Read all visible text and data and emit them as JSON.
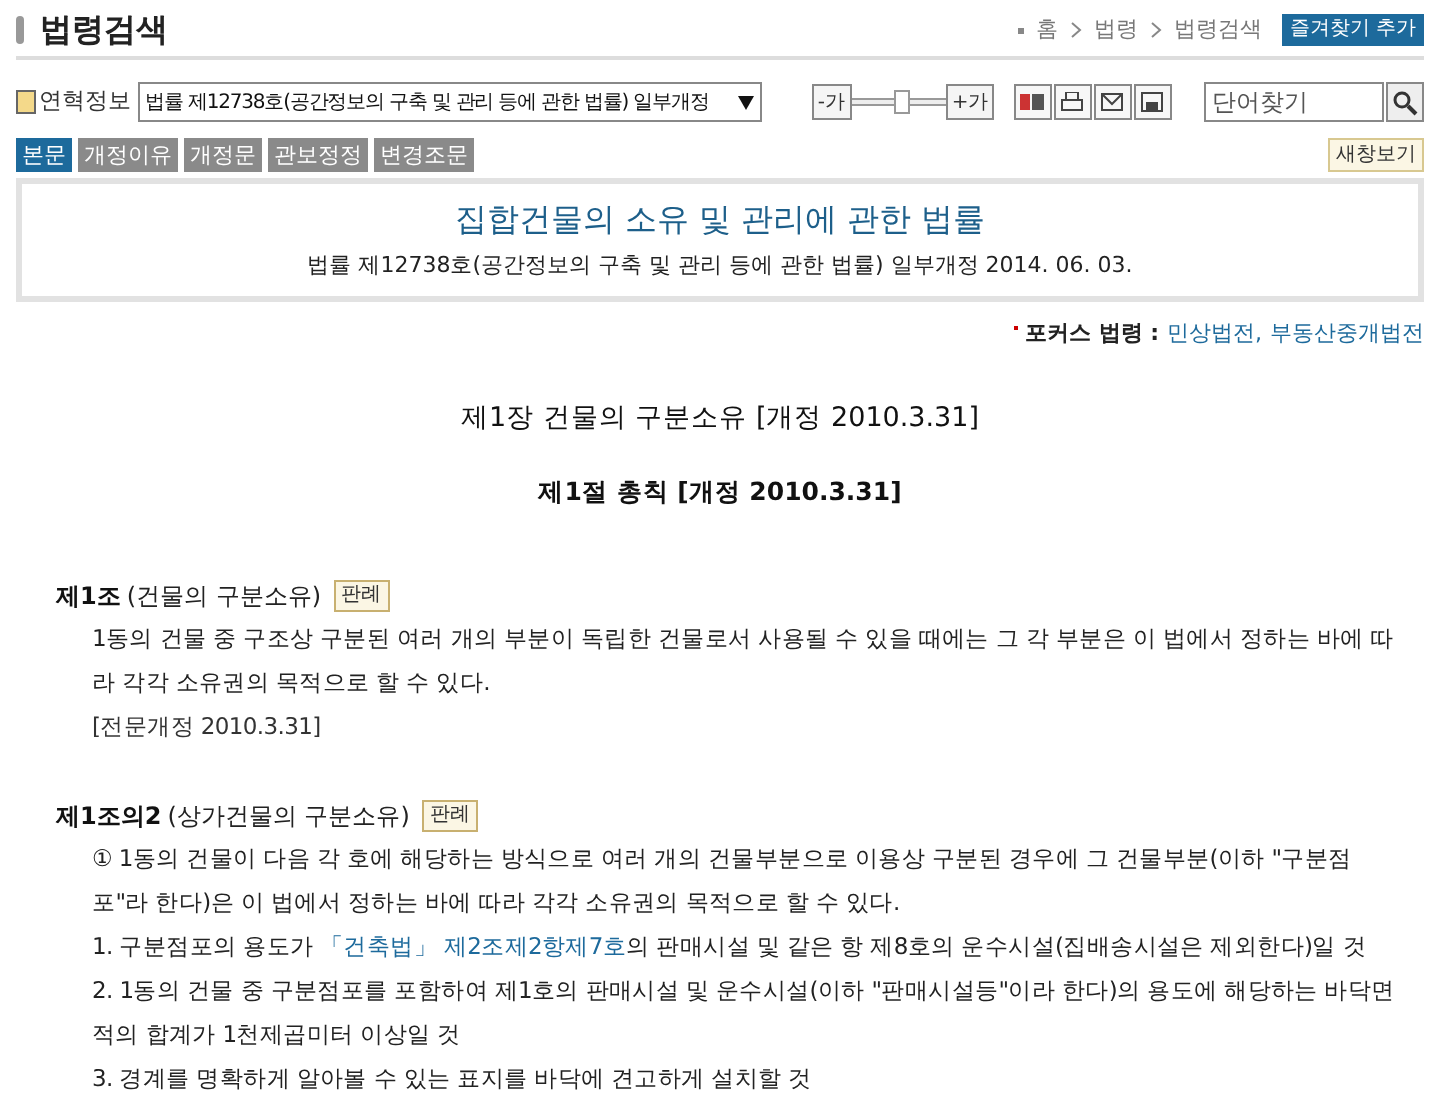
{
  "header": {
    "title": "법령검색",
    "breadcrumbs": [
      "홈",
      "법령",
      "법령검색"
    ],
    "favorite_button": "즐겨찾기 추가"
  },
  "toolbar": {
    "history_label": "연혁정보",
    "history_value": "법률 제12738호(공간정보의 구축 및 관리 등에 관한 법률) 일부개정",
    "font_smaller": "-가",
    "font_larger": "+가",
    "font_slider": {
      "level": 0.5
    },
    "search_placeholder": "단어찾기"
  },
  "tabs": [
    {
      "label": "본문",
      "selected": true
    },
    {
      "label": "개정이유",
      "selected": false
    },
    {
      "label": "개정문",
      "selected": false
    },
    {
      "label": "관보정정",
      "selected": false
    },
    {
      "label": "변경조문",
      "selected": false
    }
  ],
  "new_window_button": "새창보기",
  "law": {
    "title": "집합건물의 소유 및 관리에 관한 법률",
    "subtitle": "법률 제12738호(공간정보의 구축 및 관리 등에 관한 법률) 일부개정 2014. 06. 03."
  },
  "focus": {
    "label": "포커스 법령 :",
    "links": [
      "민상법전,",
      "부동산중개법전"
    ]
  },
  "chapter": "제1장 건물의 구분소유 [개정 2010.3.31]",
  "section": "제1절 총칙 [개정 2010.3.31]",
  "articles": [
    {
      "number": "제1조",
      "heading": "(건물의 구분소유)",
      "case_button": "판례",
      "paragraphs": [
        {
          "kind": "text",
          "parts": [
            {
              "text": "1동의 건물 중 구조상 구분된 여러 개의 부분이 독립한 건물로서 사용될 수 있을 때에는 그 각 부분은 이 법에서 정하는 바에 따라 각각 소유권의 목적으로 할 수 있다."
            }
          ]
        },
        {
          "kind": "note",
          "parts": [
            {
              "text": "[전문개정 2010.3.31]"
            }
          ]
        }
      ]
    },
    {
      "number": "제1조의2",
      "heading": "(상가건물의 구분소유)",
      "case_button": "판례",
      "paragraphs": [
        {
          "kind": "text",
          "parts": [
            {
              "text": "① 1동의 건물이 다음 각 호에 해당하는 방식으로 여러 개의 건물부분으로 이용상 구분된 경우에 그 건물부분(이하 \"구분점포\"라 한다)은 이 법에서 정하는 바에 따라 각각 소유권의 목적으로 할 수 있다."
            }
          ]
        },
        {
          "kind": "item",
          "parts": [
            {
              "text": "1. 구분점포의 용도가 "
            },
            {
              "text": "「건축법」 제2조제2항제7호",
              "link": true
            },
            {
              "text": "의 판매시설 및 같은 항 제8호의 운수시설(집배송시설은 제외한다)일 것"
            }
          ]
        },
        {
          "kind": "item",
          "parts": [
            {
              "text": "2. 1동의 건물 중 구분점포를 포함하여 제1호의 판매시설 및 운수시설(이하 \"판매시설등\"이라 한다)의 용도에 해당하는 바닥면적의 합계가 1천제곱미터 이상일 것"
            }
          ]
        },
        {
          "kind": "item",
          "parts": [
            {
              "text": "3. 경계를 명확하게 알아볼 수 있는 표지를 바닥에 견고하게 설치할 것"
            }
          ]
        }
      ]
    }
  ]
}
